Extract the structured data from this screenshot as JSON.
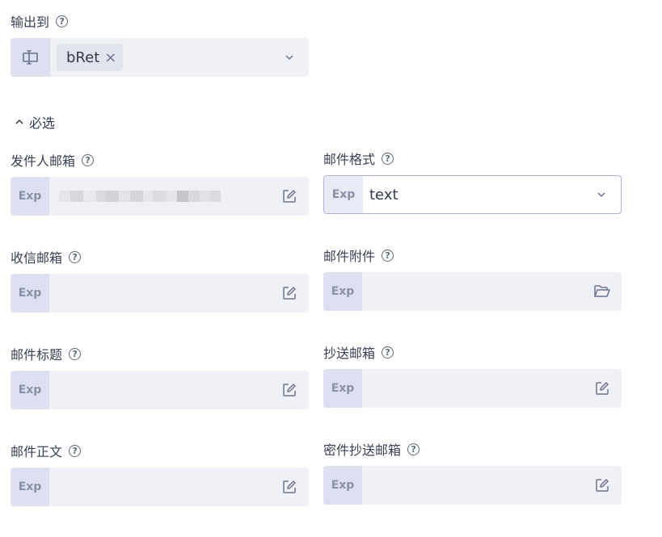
{
  "output": {
    "label": "输出到",
    "chip": "bRet",
    "chip_remove": "×"
  },
  "section": {
    "toggle": "⌃",
    "title": "必选"
  },
  "fields": {
    "sender": {
      "label": "发件人邮箱",
      "exp": "Exp"
    },
    "format": {
      "label": "邮件格式",
      "exp": "Exp",
      "value": "text"
    },
    "recipient": {
      "label": "收信邮箱",
      "exp": "Exp"
    },
    "attachment": {
      "label": "邮件附件",
      "exp": "Exp"
    },
    "subject": {
      "label": "邮件标题",
      "exp": "Exp"
    },
    "cc": {
      "label": "抄送邮箱",
      "exp": "Exp"
    },
    "body": {
      "label": "邮件正文",
      "exp": "Exp"
    },
    "bcc": {
      "label": "密件抄送邮箱",
      "exp": "Exp"
    }
  },
  "icons": {
    "help": "help-circle-icon",
    "variable": "variable-cursor-icon",
    "dropdown": "chevron-down-icon",
    "edit": "edit-icon",
    "folder": "folder-open-icon"
  },
  "colors": {
    "field_bg": "#f0f1f6",
    "exp_bg": "#dde0f0",
    "active_border": "#a9b2d9"
  }
}
